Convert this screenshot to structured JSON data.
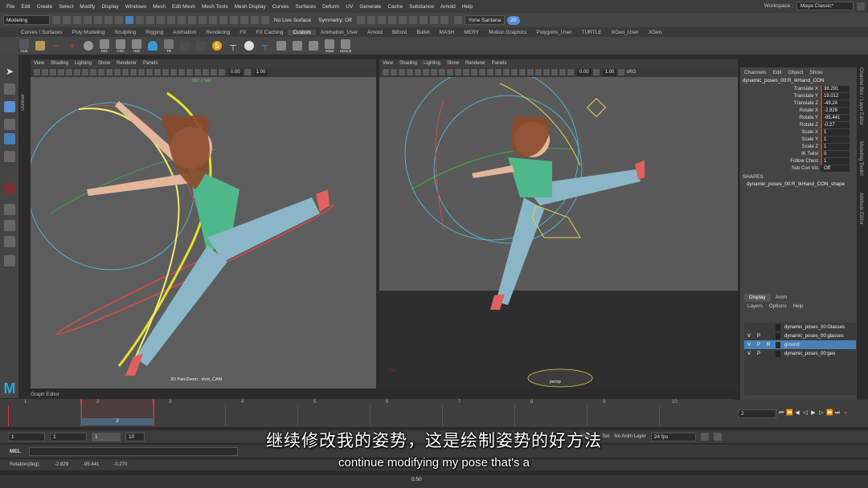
{
  "menubar": {
    "items": [
      "File",
      "Edit",
      "Create",
      "Select",
      "Modify",
      "Display",
      "Windows",
      "Mesh",
      "Edit Mesh",
      "Mesh Tools",
      "Mesh Display",
      "Curves",
      "Surfaces",
      "Deform",
      "UV",
      "Generate",
      "Cache",
      "Substance",
      "Arnold",
      "Help"
    ],
    "workspace_label": "Workspace :",
    "workspace_value": "Maya Classic*"
  },
  "statusline": {
    "mode": "Modeling",
    "live_surface": "No Live Surface",
    "symmetry": "Symmetry: Off",
    "user": "Yone Santana",
    "count": "20"
  },
  "shelf_tabs": [
    "Curves / Surfaces",
    "Poly Modeling",
    "Sculpting",
    "Rigging",
    "Animation",
    "Rendering",
    "FX",
    "FX Caching",
    "Custom",
    "Animation_User",
    "Arnold",
    "Bifrost",
    "Bullet",
    "MASH",
    "MERY",
    "Motion Graphics",
    "Polygons_User",
    "TURTLE",
    "XGen_User",
    "XGen"
  ],
  "shelf_active": "Custom",
  "shelf_labels": {
    "aln": "ALN",
    "del": "DEL",
    "chin": "Chin",
    "hair": "Hair",
    "tr": "TR",
    "mute": "Mute",
    "unmute": "Unmuh",
    "five": "5"
  },
  "outliner_tab": "Outliner",
  "panels": {
    "menu": [
      "View",
      "Shading",
      "Lighting",
      "Show",
      "Renderer",
      "Panels"
    ],
    "field_a": "0.00",
    "field_b": "1.00",
    "srgb": "sRG",
    "left_camera": "2D Pan/Zoom : shot_CAM",
    "left_resolution": "960 x 540",
    "right_camera": "persp"
  },
  "channelbox": {
    "menu": [
      "Channels",
      "Edit",
      "Object",
      "Show"
    ],
    "node": "dynamic_poses_00:R_IkHand_CON",
    "attributes": [
      {
        "name": "Translate X",
        "value": "38.291",
        "keyed": true
      },
      {
        "name": "Translate Y",
        "value": "19.012",
        "keyed": true
      },
      {
        "name": "Translate Z",
        "value": "-49.24",
        "keyed": true
      },
      {
        "name": "Rotate X",
        "value": "-2.829",
        "keyed": true
      },
      {
        "name": "Rotate Y",
        "value": "-95.441",
        "keyed": true
      },
      {
        "name": "Rotate Z",
        "value": "-0.27",
        "keyed": true
      },
      {
        "name": "Scale X",
        "value": "1",
        "keyed": true
      },
      {
        "name": "Scale Y",
        "value": "1",
        "keyed": true
      },
      {
        "name": "Scale Z",
        "value": "1",
        "keyed": true
      },
      {
        "name": "IK Twist",
        "value": "0",
        "keyed": true
      },
      {
        "name": "Follow Chest",
        "value": "1",
        "keyed": true
      },
      {
        "name": "Sub Con Vis",
        "value": "Off",
        "keyed": false
      }
    ],
    "shapes_header": "SHAPES",
    "shape_name": "dynamic_poses_00:R_IkHand_CON_shape"
  },
  "layer_editor": {
    "tabs": [
      "Display",
      "Anim"
    ],
    "menu": [
      "Layers",
      "Options",
      "Help"
    ],
    "layers": [
      {
        "v": "",
        "p": "",
        "r": "",
        "name": "dynamic_poses_00:Glasses",
        "color": "#222222",
        "selected": false
      },
      {
        "v": "V",
        "p": "P",
        "r": "",
        "name": "dynamic_poses_00:glasses",
        "color": "#222222",
        "selected": false
      },
      {
        "v": "V",
        "p": "P",
        "r": "R",
        "name": "ground",
        "color": "#2a2a2a",
        "selected": true
      },
      {
        "v": "V",
        "p": "P",
        "r": "",
        "name": "dynamic_poses_00:geo",
        "color": "#222222",
        "selected": false
      }
    ]
  },
  "side_tabs": {
    "channel_box": "Channel Box / Layer Editor",
    "modeling_toolkit": "Modeling Toolkit",
    "attribute_editor": "Attribute Editor"
  },
  "timeline": {
    "graph_editor": "Graph Editor",
    "ticks": [
      "1",
      "2",
      "3",
      "4",
      "5",
      "6",
      "7",
      "8",
      "9",
      "10"
    ],
    "current_frame_label": "2",
    "current_frame": "2"
  },
  "range": {
    "start": "1",
    "playback_start": "1",
    "range_label": "1",
    "range_end": "10",
    "character_set": "No Character Set",
    "anim_layer": "No Anim Layer",
    "fps": "24 fps"
  },
  "mel": {
    "label": "MEL"
  },
  "helpline": {
    "rotation_label": "Rotation(deg):",
    "rx": "-2.829",
    "ry": "-95.441",
    "rz": "-0.270"
  },
  "bottom": {
    "zoom": "0.50"
  },
  "subtitles": {
    "zh": "继续修改我的姿势，这是绘制姿势的好方法",
    "en": "continue modifying my pose that's a"
  },
  "colors": {
    "accent_blue": "#4a7fb5",
    "key_red": "#c23c3c",
    "maya_teal": "#2fa8d8"
  }
}
